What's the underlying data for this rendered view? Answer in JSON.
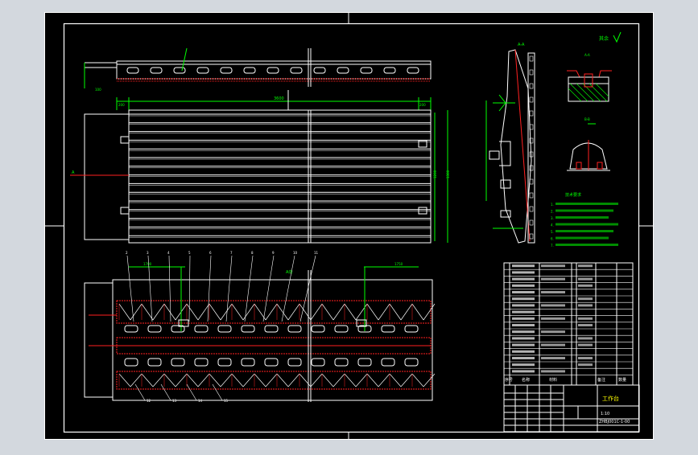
{
  "drawing": {
    "note_title": "技术要求",
    "notes": [
      "1.",
      "2.",
      "3.",
      "4.",
      "5.",
      "6.",
      "7."
    ],
    "roughness_label": "其余",
    "section_label_a": "A-A",
    "section_label_b": "B-B",
    "view_label": "A向",
    "dims": {
      "top_len": "3600",
      "plan_len": "3600",
      "plan_left": "200",
      "plan_right": "200",
      "plan_h1": "1200",
      "plan_h2": "1300",
      "elev_dim_left": "1700",
      "elev_dim_right": "1750",
      "left_mark": "A"
    },
    "balloons_top": [
      "2",
      "3",
      "4",
      "5",
      "6",
      "7",
      "8",
      "9",
      "10",
      "11"
    ],
    "balloons_bottom": [
      "12",
      "13",
      "14",
      "15"
    ],
    "bom_headers": {
      "seq": "序号",
      "name": "名称",
      "material": "材料",
      "remark": "备注"
    },
    "title_block": {
      "name": "工作台",
      "scale": "1:10",
      "drawing_no": "ZHBJ001C-1-00",
      "material_hdr": "数量"
    }
  },
  "colors": {
    "paper": "#000000",
    "frame": "#ffffff",
    "green": "#00ff00",
    "red": "#ff2020",
    "yellow": "#ffff00",
    "cyan": "#00ffff",
    "magenta": "#ff00ff",
    "bg": "#d3d8de"
  }
}
